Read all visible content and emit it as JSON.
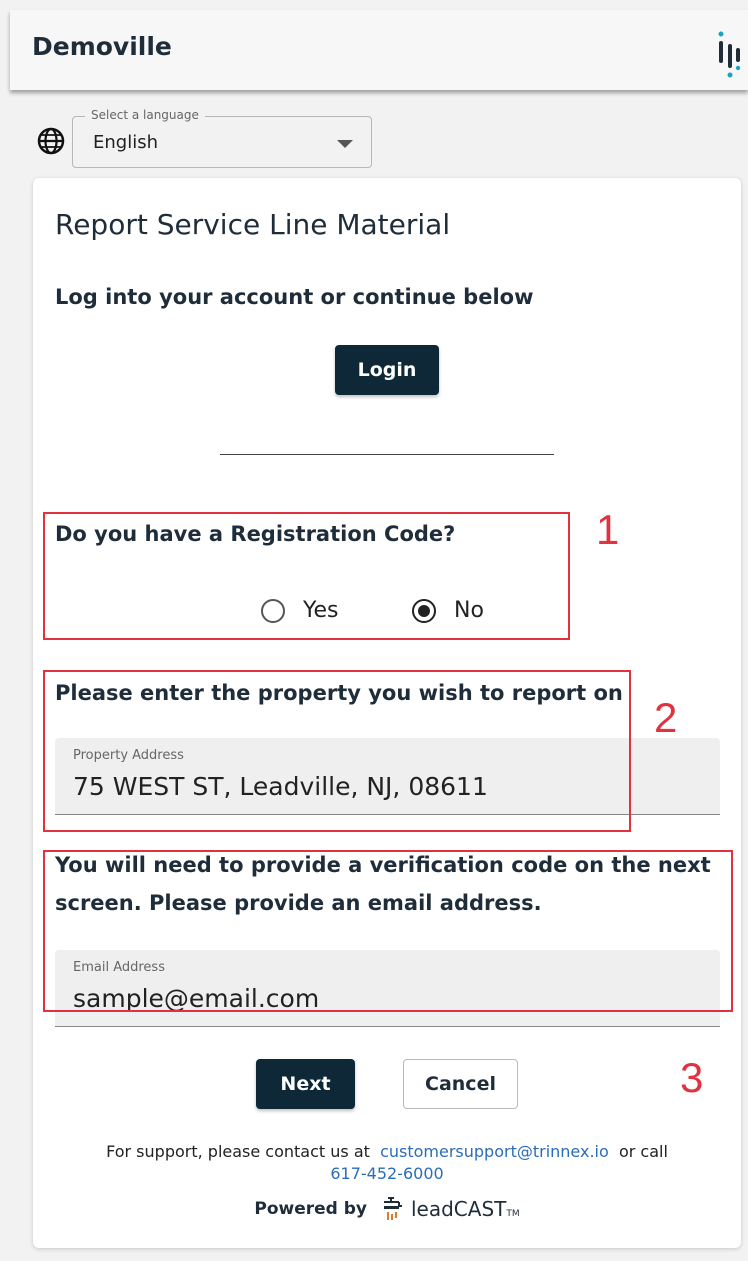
{
  "header": {
    "title": "Demoville",
    "logo_icon": "trinnex-dots-logo"
  },
  "language": {
    "legend": "Select a language",
    "value": "English"
  },
  "card": {
    "title": "Report Service Line Material",
    "login_prompt": "Log into your account or continue below",
    "login_label": "Login",
    "registration_question": "Do you have a Registration Code?",
    "radio_yes": "Yes",
    "radio_no": "No",
    "selected": "No",
    "property_prompt": "Please enter the property you wish to report on",
    "property_caption": "Property Address",
    "property_value": "75 WEST ST, Leadville, NJ, 08611",
    "email_prompt": "You will need to provide a verification code on the next screen. Please provide an email address.",
    "email_caption": "Email Address",
    "email_value": "sample@email.com",
    "next_label": "Next",
    "cancel_label": "Cancel",
    "support_prefix": "For support, please contact us at",
    "support_email": "customersupport@trinnex.io",
    "support_mid": "or call",
    "support_phone": "617-452-6000",
    "powered_by": "Powered by",
    "brand_lead": "lead",
    "brand_cast": "CAST",
    "brand_tm": "TM"
  },
  "annotations": {
    "one": "1",
    "two": "2",
    "three": "3",
    "color": "#e0333f"
  },
  "colors": {
    "primary_button": "#0e2837",
    "link": "#2a6db8"
  }
}
